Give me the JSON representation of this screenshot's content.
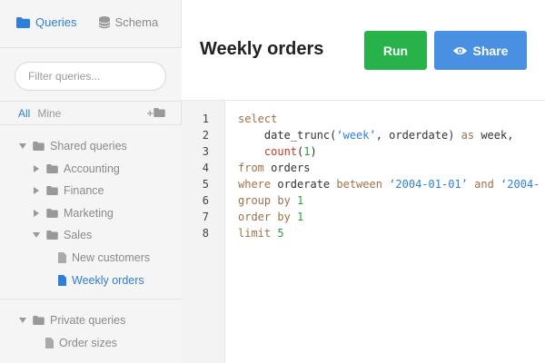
{
  "sidebar": {
    "tabs": [
      {
        "label": "Queries",
        "icon": "folder-icon"
      },
      {
        "label": "Schema",
        "icon": "database-icon"
      }
    ],
    "filter": {
      "placeholder": "Filter queries..."
    },
    "scope": {
      "all": "All",
      "mine": "Mine",
      "new_folder": "+"
    },
    "tree": {
      "shared": {
        "label": "Shared queries",
        "folders": [
          "Accounting",
          "Finance",
          "Marketing",
          "Sales"
        ],
        "sales_items": [
          "New customers",
          "Weekly orders"
        ]
      },
      "private": {
        "label": "Private queries",
        "items": [
          "Order sizes"
        ]
      }
    }
  },
  "main": {
    "title": "Weekly orders",
    "run_label": "Run",
    "share_label": "Share"
  },
  "editor": {
    "line_numbers": [
      "1",
      "2",
      "3",
      "4",
      "5",
      "6",
      "7",
      "8"
    ],
    "lines": [
      "select",
      "    date_trunc(‘week’, orderdate) as week,",
      "    count(1)",
      "from orders",
      "where orderate between ‘2004-01-01’ and ‘2004-",
      "group by 1",
      "order by 1",
      "limit 5"
    ]
  },
  "colors": {
    "accent": "#2f7ed8",
    "run": "#27b24a",
    "share": "#4a90e2",
    "keyword": "#a0704a",
    "string": "#2f7ed8",
    "number": "#2aa043"
  }
}
